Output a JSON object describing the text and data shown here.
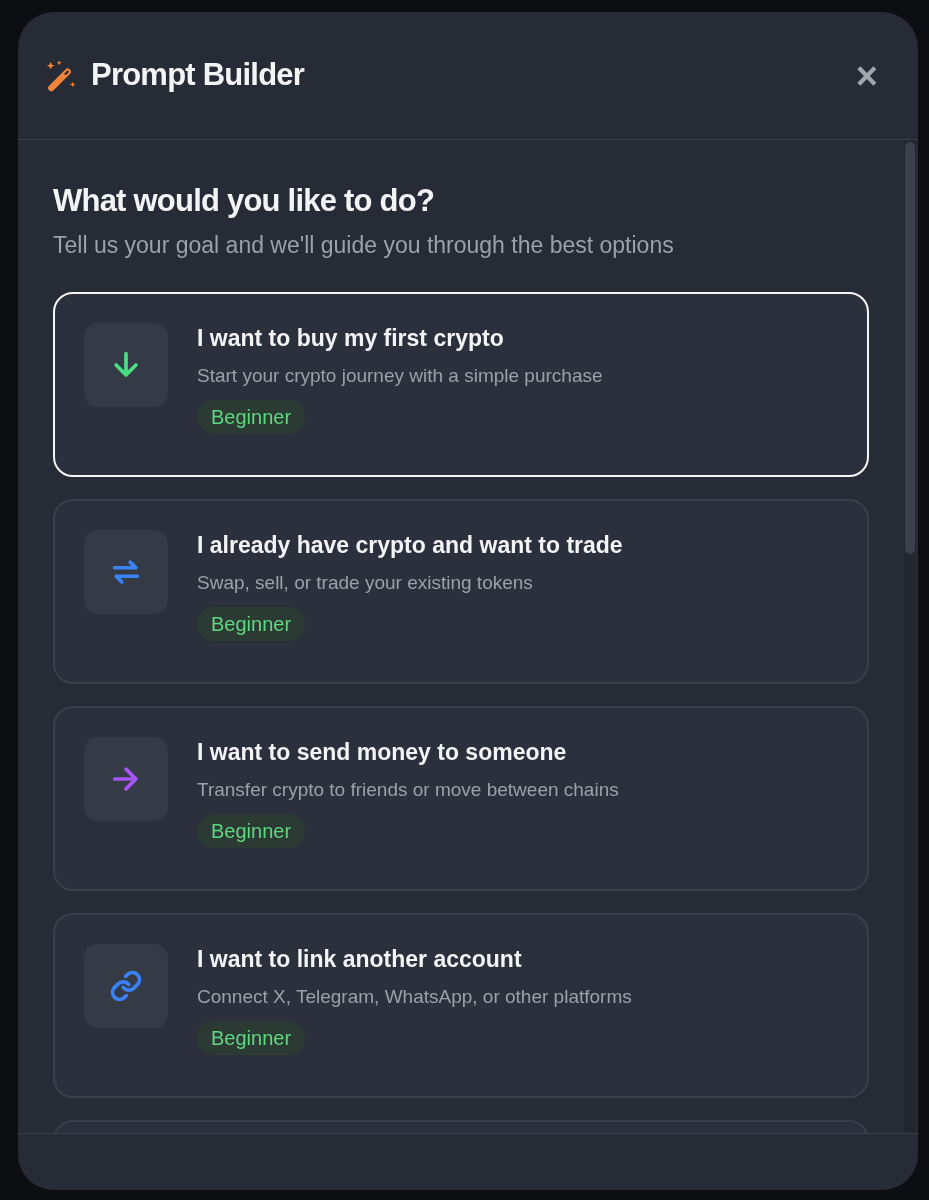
{
  "dialog": {
    "title": "Prompt Builder",
    "close": "×"
  },
  "heading": "What would you like to do?",
  "subheading": "Tell us your goal and we'll guide you through the best options",
  "options": [
    {
      "kind": "buy",
      "color": "#4ade80",
      "title": "I want to buy my first crypto",
      "description": "Start your crypto journey with a simple purchase",
      "badge": "Beginner",
      "selected": true
    },
    {
      "kind": "trade",
      "color": "#3b82f6",
      "title": "I already have crypto and want to trade",
      "description": "Swap, sell, or trade your existing tokens",
      "badge": "Beginner",
      "selected": false
    },
    {
      "kind": "send",
      "color": "#a855f7",
      "title": "I want to send money to someone",
      "description": "Transfer crypto to friends or move between chains",
      "badge": "Beginner",
      "selected": false
    },
    {
      "kind": "link",
      "color": "#3b82f6",
      "title": "I want to link another account",
      "description": "Connect X, Telegram, WhatsApp, or other platforms",
      "badge": "Beginner",
      "selected": false
    }
  ]
}
